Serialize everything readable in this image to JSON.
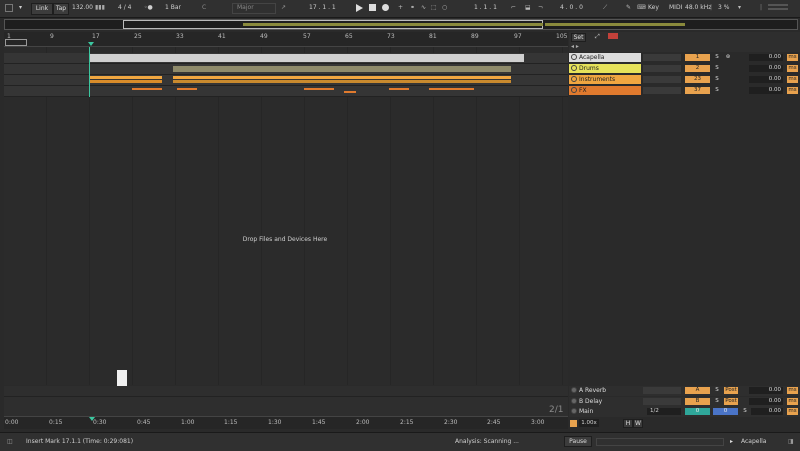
{
  "toolbar": {
    "link": "Link",
    "tap": "Tap",
    "tempo": "132.00",
    "signature": "4 / 4",
    "quantize": "1 Bar",
    "key_root": "C",
    "key_scale": "Major",
    "position": "17 . 1 . 1",
    "loop_start": "1 . 1 . 1",
    "loop_length": "4 . 0 . 0",
    "key": "Key",
    "midi": "MIDI",
    "sample_rate": "48.0 kHz",
    "cpu": "3 %"
  },
  "ruler": {
    "bars": [
      "1",
      "9",
      "17",
      "25",
      "33",
      "41",
      "49",
      "57",
      "65",
      "73",
      "81",
      "89",
      "97",
      "105"
    ]
  },
  "arrangement": {
    "drop_text": "Drop Files and Devices Here",
    "pager": "2/1"
  },
  "mixer_header": {
    "set": "Set"
  },
  "tracks": [
    {
      "name": "Acapella",
      "number": "1",
      "solo": "S",
      "volume": "0.00",
      "unit": "ms",
      "color": "#dcdcdc"
    },
    {
      "name": "Drums",
      "number": "2",
      "solo": "S",
      "volume": "0.00",
      "unit": "ms",
      "color": "#e6e25a"
    },
    {
      "name": "Instruments",
      "number": "23",
      "solo": "S",
      "volume": "0.00",
      "unit": "ms",
      "color": "#f0a640"
    },
    {
      "name": "FX",
      "number": "37",
      "solo": "S",
      "volume": "0.00",
      "unit": "ms",
      "color": "#e07a2e"
    }
  ],
  "returns": [
    {
      "name": "A Reverb",
      "letter": "A",
      "solo": "S",
      "post": "Post",
      "volume": "0.00",
      "unit": "ms"
    },
    {
      "name": "B Delay",
      "letter": "B",
      "solo": "S",
      "post": "Post",
      "volume": "0.00",
      "unit": "ms"
    },
    {
      "name": "Main",
      "routing": "1/2",
      "a": "0",
      "b": "0",
      "solo": "S",
      "volume": "0.00",
      "unit": "ms"
    }
  ],
  "timebar": {
    "times": [
      "0:00",
      "0:15",
      "0:30",
      "0:45",
      "1:00",
      "1:15",
      "1:30",
      "1:45",
      "2:00",
      "2:15",
      "2:30",
      "2:45",
      "3:00"
    ]
  },
  "status": {
    "insert_mark": "Insert Mark 17.1.1 (Time: 0:29:081)",
    "analysis": "Analysis: Scanning ...",
    "pause": "Pause",
    "zoom": "1.00x",
    "h": "H",
    "w": "W",
    "selected_track": "Acapella"
  }
}
